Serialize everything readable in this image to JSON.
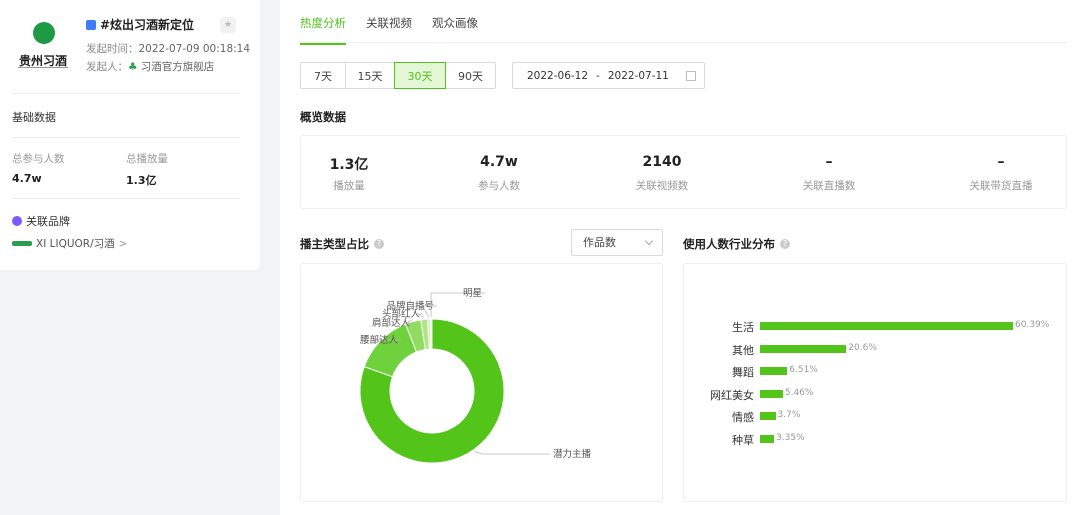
{
  "topic": {
    "logo_text": "贵州习酒",
    "title": "#炫出习酒新定位",
    "start_time_label": "发起时间：",
    "start_time": "2022-07-09 00:18:14",
    "initiator_label": "发起人：",
    "initiator": "习酒官方旗舰店"
  },
  "basic": {
    "section_title": "基础数据",
    "participants_label": "总参与人数",
    "participants_value": "4.7w",
    "plays_label": "总播放量",
    "plays_value": "1.3亿"
  },
  "brand": {
    "section_title": "关联品牌",
    "item": "XI LIQUOR/习酒",
    "chevron": ">"
  },
  "tabs": [
    "热度分析",
    "关联视频",
    "观众画像"
  ],
  "active_tab": 0,
  "range": {
    "buttons": [
      "7天",
      "15天",
      "30天",
      "90天"
    ],
    "active": 2,
    "start_date": "2022-06-12",
    "separator": "-",
    "end_date": "2022-07-11"
  },
  "overview": {
    "title": "概览数据",
    "items": [
      {
        "value": "1.3亿",
        "label": "播放量"
      },
      {
        "value": "4.7w",
        "label": "参与人数"
      },
      {
        "value": "2140",
        "label": "关联视频数"
      },
      {
        "value": "–",
        "label": "关联直播数"
      },
      {
        "value": "–",
        "label": "关联带货直播"
      }
    ]
  },
  "anchor_section": {
    "title": "播主类型占比",
    "select_value": "作品数"
  },
  "industry_section": {
    "title": "使用人数行业分布"
  },
  "colors": {
    "accent": "#52c41a",
    "donut": [
      "#52c41a",
      "#6fd13c",
      "#8fdc60",
      "#aee685",
      "#c9efac",
      "#e3f6d5"
    ]
  },
  "chart_data": [
    {
      "type": "pie",
      "title": "播主类型占比",
      "categories": [
        "潜力主播",
        "腰部达人",
        "肩部达人",
        "头部红人",
        "品牌自播号",
        "明星"
      ],
      "values": [
        80.5,
        13.5,
        3.5,
        1.5,
        0.6,
        0.4
      ],
      "donut": true
    },
    {
      "type": "bar",
      "orientation": "horizontal",
      "title": "使用人数行业分布",
      "categories": [
        "生活",
        "其他",
        "舞蹈",
        "网红美女",
        "情感",
        "种草"
      ],
      "values": [
        60.39,
        20.6,
        6.51,
        5.46,
        3.7,
        3.35
      ],
      "value_labels": [
        "60.39%",
        "20.6%",
        "6.51%",
        "5.46%",
        "3.7%",
        "3.35%"
      ],
      "xlim": [
        0,
        60.39
      ]
    }
  ]
}
